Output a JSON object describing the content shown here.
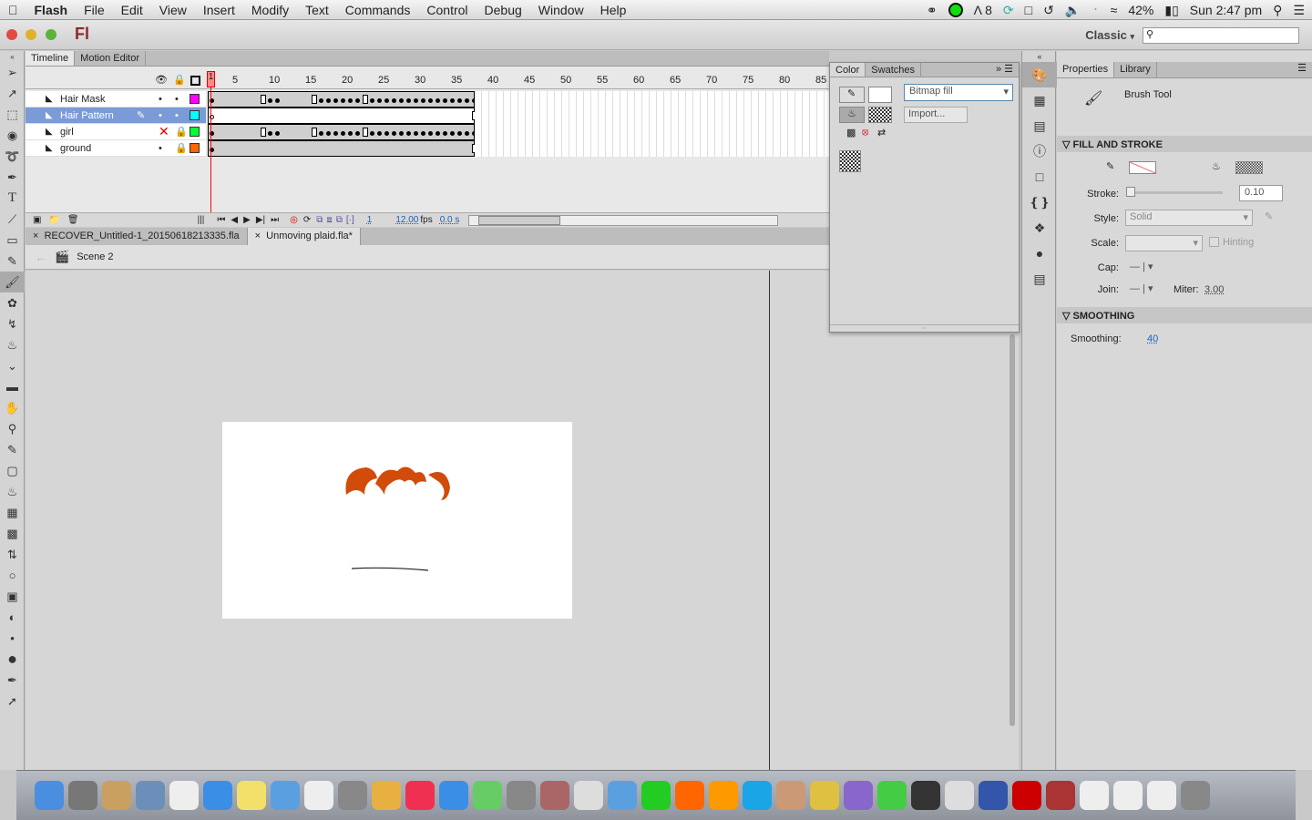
{
  "menubar": {
    "apple": "",
    "items": [
      "Flash",
      "File",
      "Edit",
      "View",
      "Insert",
      "Modify",
      "Text",
      "Commands",
      "Control",
      "Debug",
      "Window",
      "Help"
    ],
    "status": {
      "adobe_count": "8",
      "battery": "42%",
      "clock": "Sun 2:47 pm"
    }
  },
  "titlebar": {
    "logo": "Fl",
    "workspace": "Classic",
    "search_value": ""
  },
  "timeline": {
    "tabs": [
      "Timeline",
      "Motion Editor"
    ],
    "ruler": [
      "1",
      "5",
      "10",
      "15",
      "20",
      "25",
      "30",
      "35",
      "40",
      "45",
      "50",
      "55",
      "60",
      "65",
      "70",
      "75",
      "80",
      "85"
    ],
    "layers": [
      {
        "name": "Hair Mask",
        "color": "#ff00ff",
        "selected": false,
        "keyframes": [
          1,
          9,
          10,
          16,
          17,
          18,
          19,
          20,
          21,
          23,
          24,
          25,
          26,
          27,
          28,
          29,
          30,
          31,
          32,
          33,
          34,
          35,
          36,
          37
        ],
        "empty_keyframes": [
          8,
          15,
          22
        ]
      },
      {
        "name": "Hair Pattern",
        "color": "#00ffff",
        "selected": true,
        "keyframes": [],
        "empty_keyframes": [
          1,
          37
        ]
      },
      {
        "name": "girl",
        "color": "#00ff33",
        "selected": false,
        "keyframes": [
          1,
          9,
          10,
          16,
          17,
          18,
          19,
          20,
          21,
          23,
          24,
          25,
          26,
          27,
          28,
          29,
          30,
          31,
          32,
          33,
          34,
          35,
          36,
          37
        ],
        "empty_keyframes": [
          8,
          15,
          22
        ]
      },
      {
        "name": "ground",
        "color": "#ff6600",
        "selected": false,
        "keyframes": [
          1
        ],
        "empty_keyframes": [
          37
        ]
      }
    ],
    "current_frame": "1",
    "fps": "12.00",
    "fps_unit": "fps",
    "time": "0.0 s"
  },
  "documents": {
    "tabs": [
      "RECOVER_Untitled-1_20150618213335.fla",
      "Unmoving plaid.fla*"
    ],
    "active": 1,
    "scene": "Scene 2"
  },
  "color_panel": {
    "tabs": [
      "Color",
      "Swatches"
    ],
    "fill_type": "Bitmap fill",
    "import_label": "Import..."
  },
  "properties": {
    "tabs": [
      "Properties",
      "Library"
    ],
    "tool_name": "Brush Tool",
    "fill_stroke": {
      "header": "FILL AND STROKE",
      "stroke_label": "Stroke:",
      "stroke_value": "0.10",
      "style_label": "Style:",
      "style_value": "Solid",
      "scale_label": "Scale:",
      "hinting_label": "Hinting",
      "cap_label": "Cap:",
      "join_label": "Join:",
      "miter_label": "Miter:",
      "miter_value": "3.00"
    },
    "smoothing": {
      "header": "SMOOTHING",
      "label": "Smoothing:",
      "value": "40"
    }
  },
  "colors": {
    "accent": "#7b9bd8",
    "playhead": "#ff0000",
    "stage": "#ffffff",
    "hair": "#d14b0a"
  }
}
